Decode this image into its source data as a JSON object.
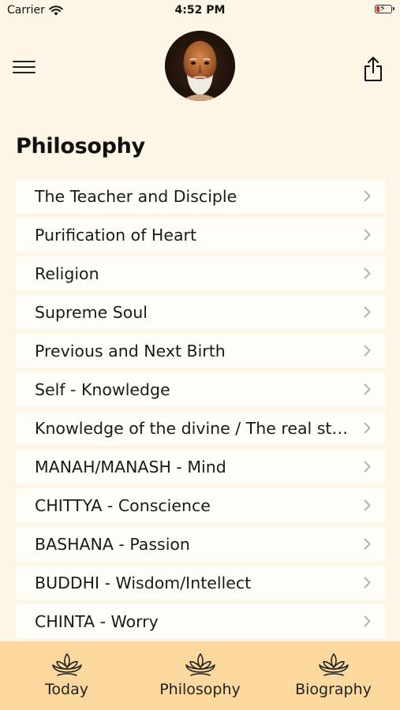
{
  "status_bar": {
    "carrier": "Carrier",
    "time": "4:52 PM"
  },
  "header": {
    "menu_icon": "hamburger-menu-icon",
    "avatar": "guru-portrait",
    "share_icon": "share-icon"
  },
  "page": {
    "title": "Philosophy"
  },
  "topics": [
    {
      "label": "The Teacher and Disciple"
    },
    {
      "label": "Purification of Heart"
    },
    {
      "label": "Religion"
    },
    {
      "label": "Supreme Soul"
    },
    {
      "label": "Previous and Next Birth"
    },
    {
      "label": "Self - Knowledge"
    },
    {
      "label": "Knowledge of the divine / The real state of the self"
    },
    {
      "label": "MANAH/MANASH - Mind"
    },
    {
      "label": "CHITTYA - Conscience"
    },
    {
      "label": "BASHANA - Passion"
    },
    {
      "label": "BUDDHI - Wisdom/Intellect"
    },
    {
      "label": "CHINTA - Worry"
    }
  ],
  "tab_bar": {
    "tabs": [
      {
        "label": "Today",
        "icon": "lotus-icon"
      },
      {
        "label": "Philosophy",
        "icon": "lotus-icon"
      },
      {
        "label": "Biography",
        "icon": "lotus-icon"
      }
    ]
  },
  "colors": {
    "background": "#fdf6e6",
    "row": "#fffdf8",
    "tab_bar": "#fbd89e",
    "battery_low": "#e0322b"
  }
}
